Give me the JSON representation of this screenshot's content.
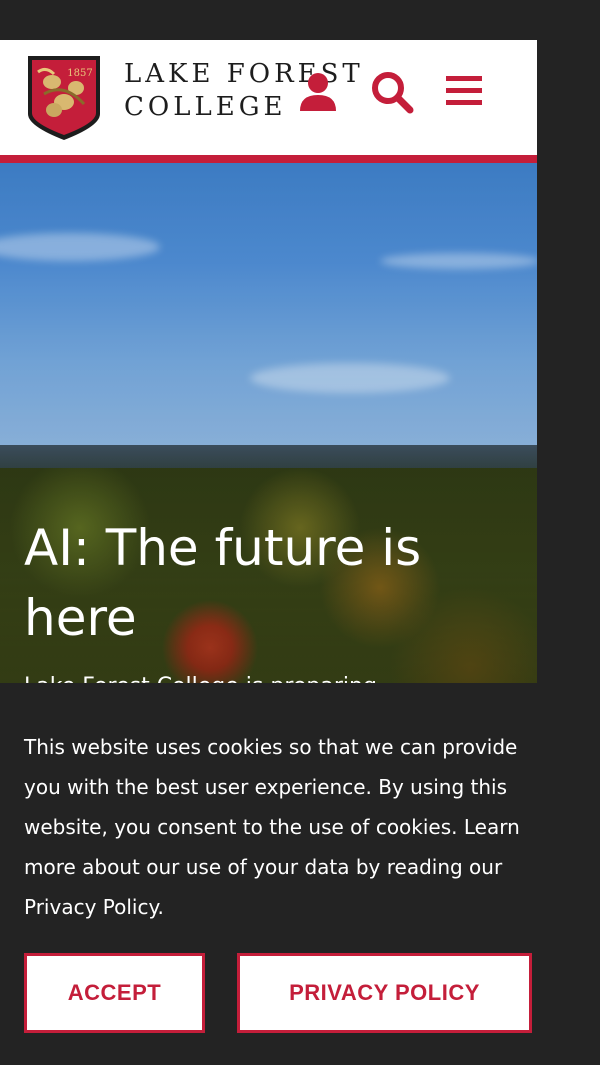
{
  "header": {
    "logo_year": "1857",
    "logo_line1": "LAKE FOREST",
    "logo_line2": "COLLEGE",
    "icons": [
      "user-icon",
      "search-icon",
      "menu-icon"
    ]
  },
  "hero": {
    "title": "AI: The future is here",
    "text": "Lake Forest College is preparing graduates to use AI ethically and"
  },
  "cookie_banner": {
    "message": "This website uses cookies so that we can provide you with the best user experience. By using this website, you consent to the use of cookies. Learn more about our use of your data by reading our Privacy Policy.",
    "accept_label": "ACCEPT",
    "privacy_label": "PRIVACY POLICY"
  },
  "colors": {
    "brand_red": "#c41e3a",
    "banner_bg": "#232323"
  }
}
